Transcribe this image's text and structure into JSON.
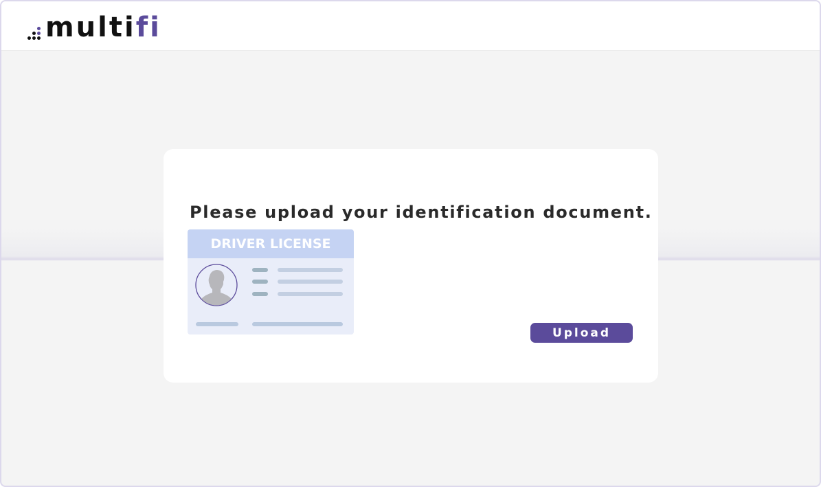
{
  "header": {
    "logo": {
      "main": "multi",
      "accent": "fi"
    }
  },
  "card": {
    "title": "Please upload your identification document.",
    "license": {
      "heading": "DRIVER LICENSE"
    },
    "upload_label": "Upload"
  },
  "icons": {
    "logo_dots": "logo-dots-icon",
    "avatar": "person-avatar-icon"
  },
  "colors": {
    "brand": "#5b4b9b",
    "license_header": "#c5d3f3",
    "license_body": "#e9edf9",
    "background": "#f4f4f4"
  }
}
